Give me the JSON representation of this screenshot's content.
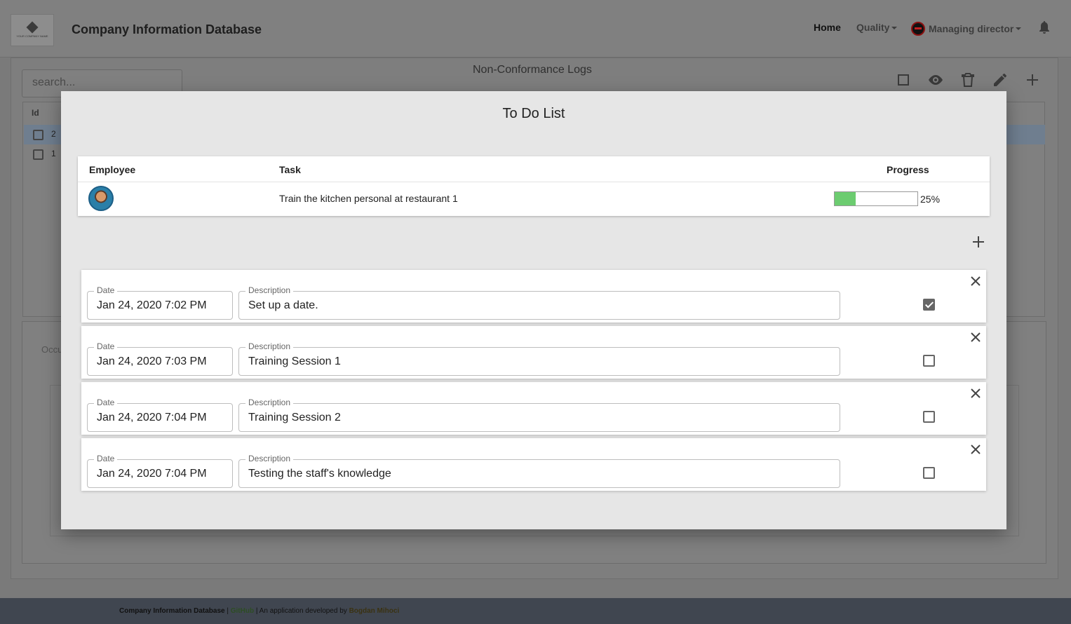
{
  "app": {
    "brand": "Company Information Database",
    "logo_text": "YOUR COMPANY NAME"
  },
  "nav": {
    "home": "Home",
    "quality": "Quality",
    "user": "Managing director"
  },
  "background": {
    "search_placeholder": "search...",
    "title": "Non-Conformance Logs",
    "table_header_id": "Id",
    "rows": [
      "2",
      "1"
    ],
    "occurrence_label": "Occu"
  },
  "modal": {
    "title": "To Do List",
    "headers": {
      "employee": "Employee",
      "task": "Task",
      "progress": "Progress"
    },
    "task": {
      "description": "Train the kitchen personal at restaurant 1",
      "progress_label": "25%",
      "progress_value": 0.25
    },
    "field_labels": {
      "date": "Date",
      "description": "Description"
    },
    "items": [
      {
        "date": "Jan 24, 2020 7:02 PM",
        "description": "Set up a date.",
        "done": true
      },
      {
        "date": "Jan 24, 2020 7:03 PM",
        "description": "Training Session 1",
        "done": false
      },
      {
        "date": "Jan 24, 2020 7:04 PM",
        "description": "Training Session 2",
        "done": false
      },
      {
        "date": "Jan 24, 2020 7:04 PM",
        "description": "Testing the staff's knowledge",
        "done": false
      }
    ]
  },
  "footer": {
    "brand": "Company Information Database",
    "separator1": " | ",
    "github": "GitHub",
    "separator2": " | An application developed by ",
    "author": "Bogdan Mihoci"
  },
  "colors": {
    "progress_fill": "#6ccc70",
    "overlay": "#7a7a7a",
    "modal_bg": "#e6e6e6"
  }
}
